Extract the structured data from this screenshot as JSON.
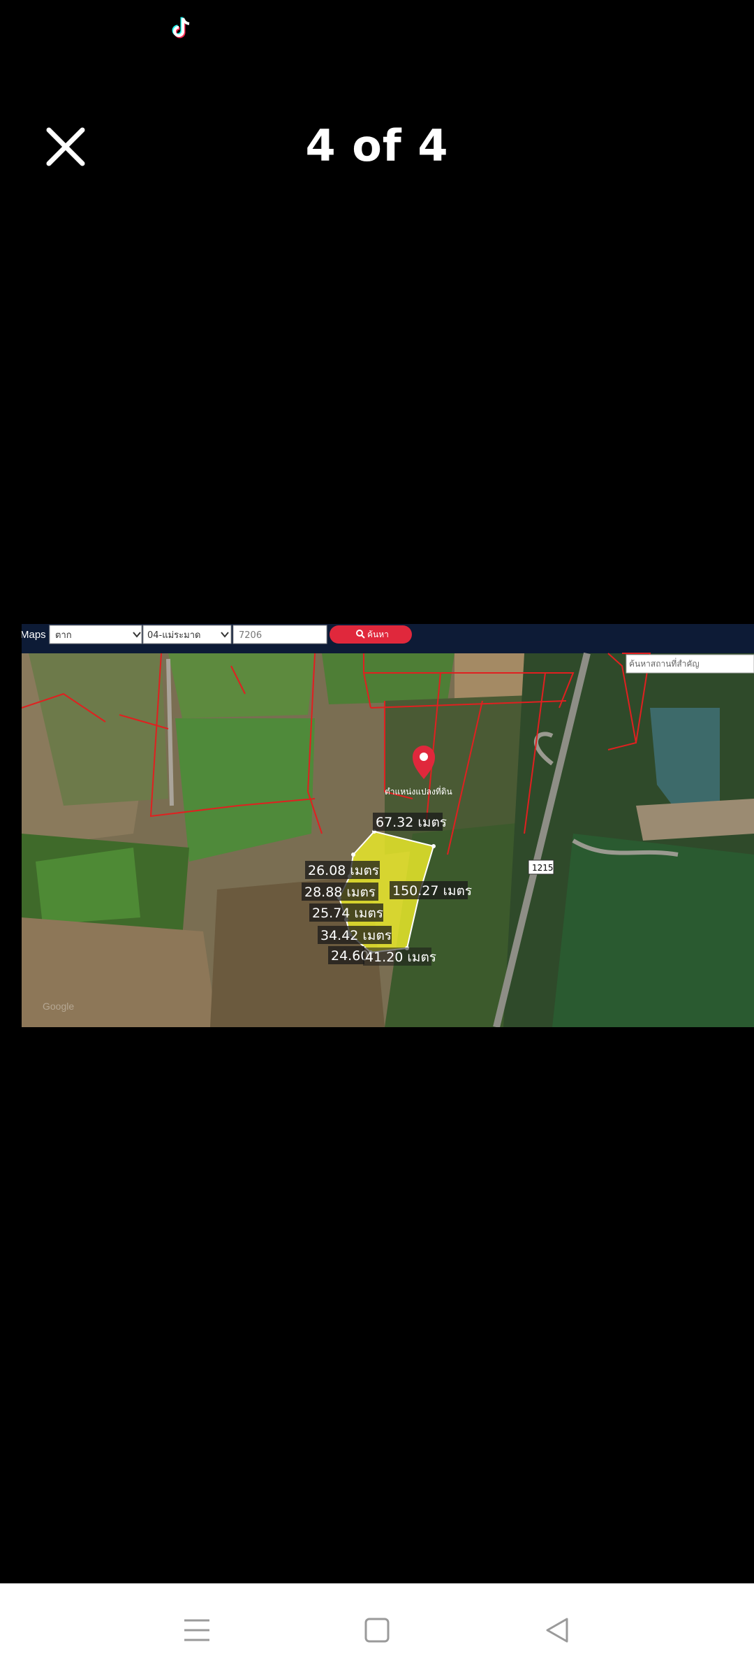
{
  "status_bar": {
    "app_icon": "tiktok-logo-icon"
  },
  "header": {
    "counter": "4 of 4",
    "close_icon": "close-icon"
  },
  "map": {
    "toolbar": {
      "brand": "Maps",
      "province_select": "ตาก",
      "district_select": "04-แม่ระมาด",
      "parcel_input": "7206",
      "search_label": "ค้นหา",
      "place_search_placeholder": "ค้นหาสถานที่สำคัญ"
    },
    "marker_label": "ตำแหน่งแปลงที่ดิน",
    "road_number": "1215",
    "measurements": [
      "67.32 เมตร",
      "26.08 เมตร",
      "28.88 เมตร",
      "150.27 เมตร",
      "25.74 เมตร",
      "34.42 เมตร",
      "24.60",
      "41.20 เมตร"
    ],
    "watermark": "Google"
  },
  "nav_bar": {
    "menu_icon": "recent-apps-icon",
    "home_icon": "home-square-icon",
    "back_icon": "back-triangle-icon"
  },
  "colors": {
    "background": "#000000",
    "nav_bar": "#ffffff",
    "parcel_fill": "#e8e82a",
    "boundary": "#e02020",
    "search_button": "#e0283c"
  }
}
